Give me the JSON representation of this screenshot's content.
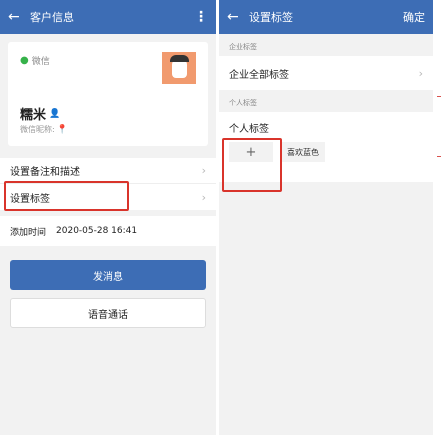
{
  "left": {
    "header": {
      "back_icon": "back-arrow-icon",
      "title": "客户信息",
      "more_icon": "more-vertical-icon"
    },
    "profile": {
      "source_label": "微信",
      "source_icon": "wechat-icon",
      "name": "糯米",
      "person_icon": "person-icon",
      "nickname_label": "微信昵称:",
      "nickname_icon": "pin-icon"
    },
    "menu": [
      {
        "label": "设置备注和描述"
      },
      {
        "label": "设置标签"
      }
    ],
    "add_time": {
      "label": "添加时间",
      "value": "2020-05-28 16:41"
    },
    "primary_button": "发消息",
    "secondary_button": "语音通话"
  },
  "right": {
    "header": {
      "back_icon": "back-arrow-icon",
      "title": "设置标签",
      "confirm": "确定"
    },
    "enterprise_section": "企业标签",
    "enterprise_row": "企业全部标签",
    "personal_section": "个人标签",
    "personal_title": "个人标签",
    "add_button": "+",
    "tags": [
      "喜欢蓝色"
    ]
  },
  "colors": {
    "header_blue": "#3d6db5",
    "highlight_red": "#d9342b",
    "wechat_green": "#36b24a"
  }
}
